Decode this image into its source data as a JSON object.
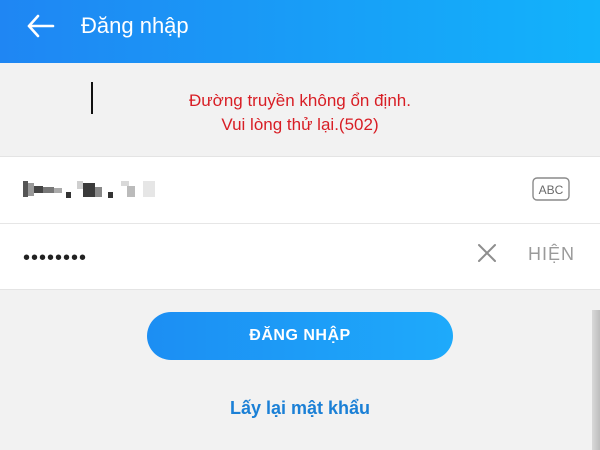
{
  "header": {
    "title": "Đăng nhập",
    "back_icon": "arrow-left-icon",
    "gradient": [
      "#1f86f3",
      "#12b3fb"
    ]
  },
  "error": {
    "line1": "Đường truyền không ổn định.",
    "line2": "Vui lòng thử lại.(502)",
    "color": "#d81e25"
  },
  "form": {
    "username_value": "",
    "username_masked": true,
    "keyboard_toggle_label": "ABC",
    "password_value": "••••••••",
    "clear_icon": "close-icon",
    "show_label": "HIỆN"
  },
  "actions": {
    "login_label": "ĐĂNG NHẬP",
    "forgot_label": "Lấy lại mật khẩu",
    "accent": "#1c8ef3"
  }
}
